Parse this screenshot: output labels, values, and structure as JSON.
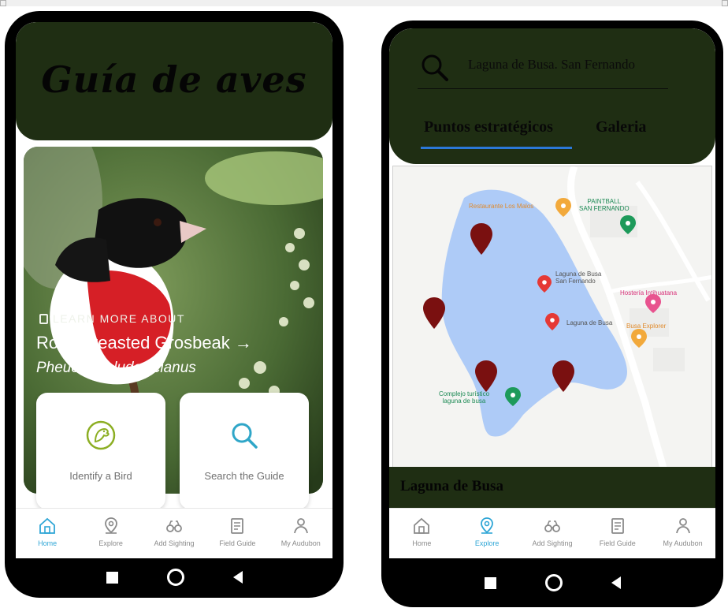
{
  "left_phone": {
    "app_title": "Guía de aves",
    "hero": {
      "kicker": "LEARN MORE ABOUT",
      "bird_name": "Rose-breasted Grosbeak →",
      "scientific_name": "Pheucticus ludovicianus"
    },
    "cards": {
      "identify_label": "Identify a Bird",
      "search_label": "Search the Guide"
    },
    "tabs": [
      {
        "label": "Home",
        "icon": "home-icon",
        "active": true
      },
      {
        "label": "Explore",
        "icon": "map-pin-icon",
        "active": false
      },
      {
        "label": "Add Sighting",
        "icon": "binoculars-icon",
        "active": false
      },
      {
        "label": "Field Guide",
        "icon": "book-icon",
        "active": false
      },
      {
        "label": "My Audubon",
        "icon": "person-icon",
        "active": false
      }
    ]
  },
  "right_phone": {
    "search_text": "Laguna de Busa. San Fernando",
    "tabs_top": [
      "Puntos estratégicos",
      "Galeria"
    ],
    "map": {
      "labels": {
        "restaurant": "Restaurante Los Malos",
        "paintball": "PAINTBALL\nSAN FERNANDO",
        "laguna_sf": "Laguna de Busa\nSan Fernando",
        "hosteria": "Hostería Intihuatana",
        "laguna": "Laguna de Busa",
        "busa_explorer": "Busa Explorer",
        "complejo": "Complejo turístico\nlaguna de busa"
      }
    },
    "place_title": "Laguna de Busa",
    "tabs": [
      {
        "label": "Home",
        "icon": "home-icon",
        "active": false
      },
      {
        "label": "Explore",
        "icon": "map-pin-icon",
        "active": true
      },
      {
        "label": "Add Sighting",
        "icon": "binoculars-icon",
        "active": false
      },
      {
        "label": "Field Guide",
        "icon": "book-icon",
        "active": false
      },
      {
        "label": "My Audubon",
        "icon": "person-icon",
        "active": false
      }
    ]
  },
  "colors": {
    "header_dark_green": "#1f2e13",
    "active_tab": "#2fa6d6",
    "lake": "#aecbf7",
    "marker": "#7a1010",
    "tab_underline": "#2b78d8"
  }
}
